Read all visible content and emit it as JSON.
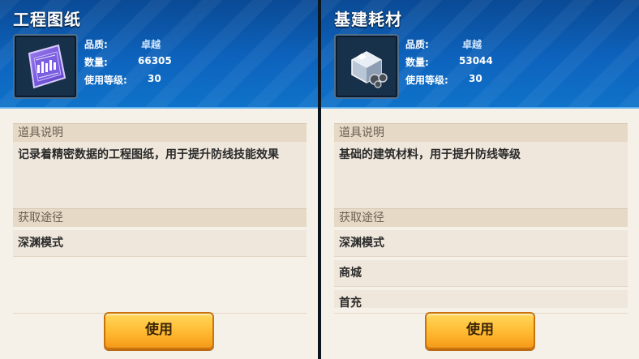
{
  "left_panel": {
    "title": "工程图纸",
    "item_icon": "blueprint-icon",
    "stats": {
      "quality_label": "品质:",
      "quality_value": "卓越",
      "quantity_label": "数量:",
      "quantity_value": "66305",
      "level_label": "使用等级:",
      "level_value": "30"
    },
    "desc_header": "道具说明",
    "description": "记录着精密数据的工程图纸，用于提升防线技能效果",
    "source_header": "获取途径",
    "sources": [
      "深渊模式"
    ],
    "use_button": "使用"
  },
  "right_panel": {
    "title": "基建耗材",
    "item_icon": "construction-material-icon",
    "stats": {
      "quality_label": "品质:",
      "quality_value": "卓越",
      "quantity_label": "数量:",
      "quantity_value": "53044",
      "level_label": "使用等级:",
      "level_value": "30"
    },
    "desc_header": "道具说明",
    "description": "基础的建筑材料，用于提升防线等级",
    "source_header": "获取途径",
    "sources": [
      "深渊模式",
      "商城",
      "首充"
    ],
    "use_button": "使用"
  },
  "colors": {
    "header_blue": "#0d63bd",
    "button_orange": "#ffb62e",
    "panel_bg": "#f6f1e8",
    "section_bg": "#e6d9c6"
  }
}
